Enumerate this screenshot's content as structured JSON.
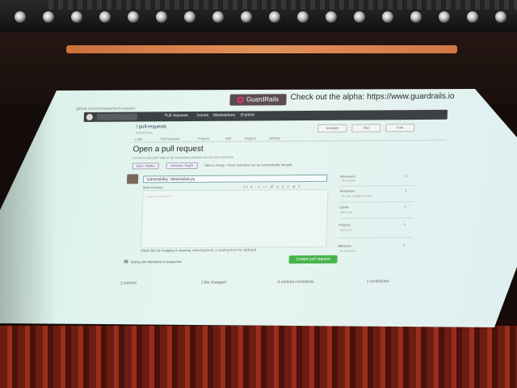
{
  "promo": {
    "brand": "GuardRails",
    "text": "Check out the alpha: https://www.guardrails.io"
  },
  "browser": {
    "url": "github.com/compare/pull-request"
  },
  "github": {
    "nav": [
      "Pull requests",
      "Issues",
      "Marketplace",
      "Explore"
    ],
    "repo_name": "/ pull-requests",
    "repo_subtitle": "forked from",
    "repo_buttons": [
      "Unwatch",
      "Star",
      "Fork"
    ],
    "tabs": [
      "Code",
      "Pull requests",
      "Projects",
      "Wiki",
      "Insights",
      "Settings"
    ],
    "page_title": "Open a pull request",
    "page_subtitle": "Create a new pull request by comparing changes across two branches.",
    "compare": {
      "base": "base: master",
      "head": "compare: bugfix",
      "status": "Able to merge. These branches can be automatically merged."
    },
    "title_value": "Vulnerability: deserialize.py",
    "editor_tabs": "Write    Preview",
    "editor_tools": "AA B i ≡ <> 🔗  ≣ ≣ ☑  @ ⎘",
    "editor_placeholder": "Leave a comment",
    "help_text": "Attach files by dragging & dropping, selecting them, or pasting from the clipboard.",
    "draft_note": "Styling with Markdown is supported",
    "create_button": "Create pull request",
    "sidebar": [
      {
        "heading": "Reviewers",
        "value": "No reviews"
      },
      {
        "heading": "Assignees",
        "value": "No one—assign yourself"
      },
      {
        "heading": "Labels",
        "value": "None yet"
      },
      {
        "heading": "Projects",
        "value": "None yet"
      },
      {
        "heading": "Milestone",
        "value": "No milestone"
      }
    ],
    "stats": [
      "1 commit",
      "1 file changed",
      "0 commit comments",
      "1 contributor"
    ]
  }
}
